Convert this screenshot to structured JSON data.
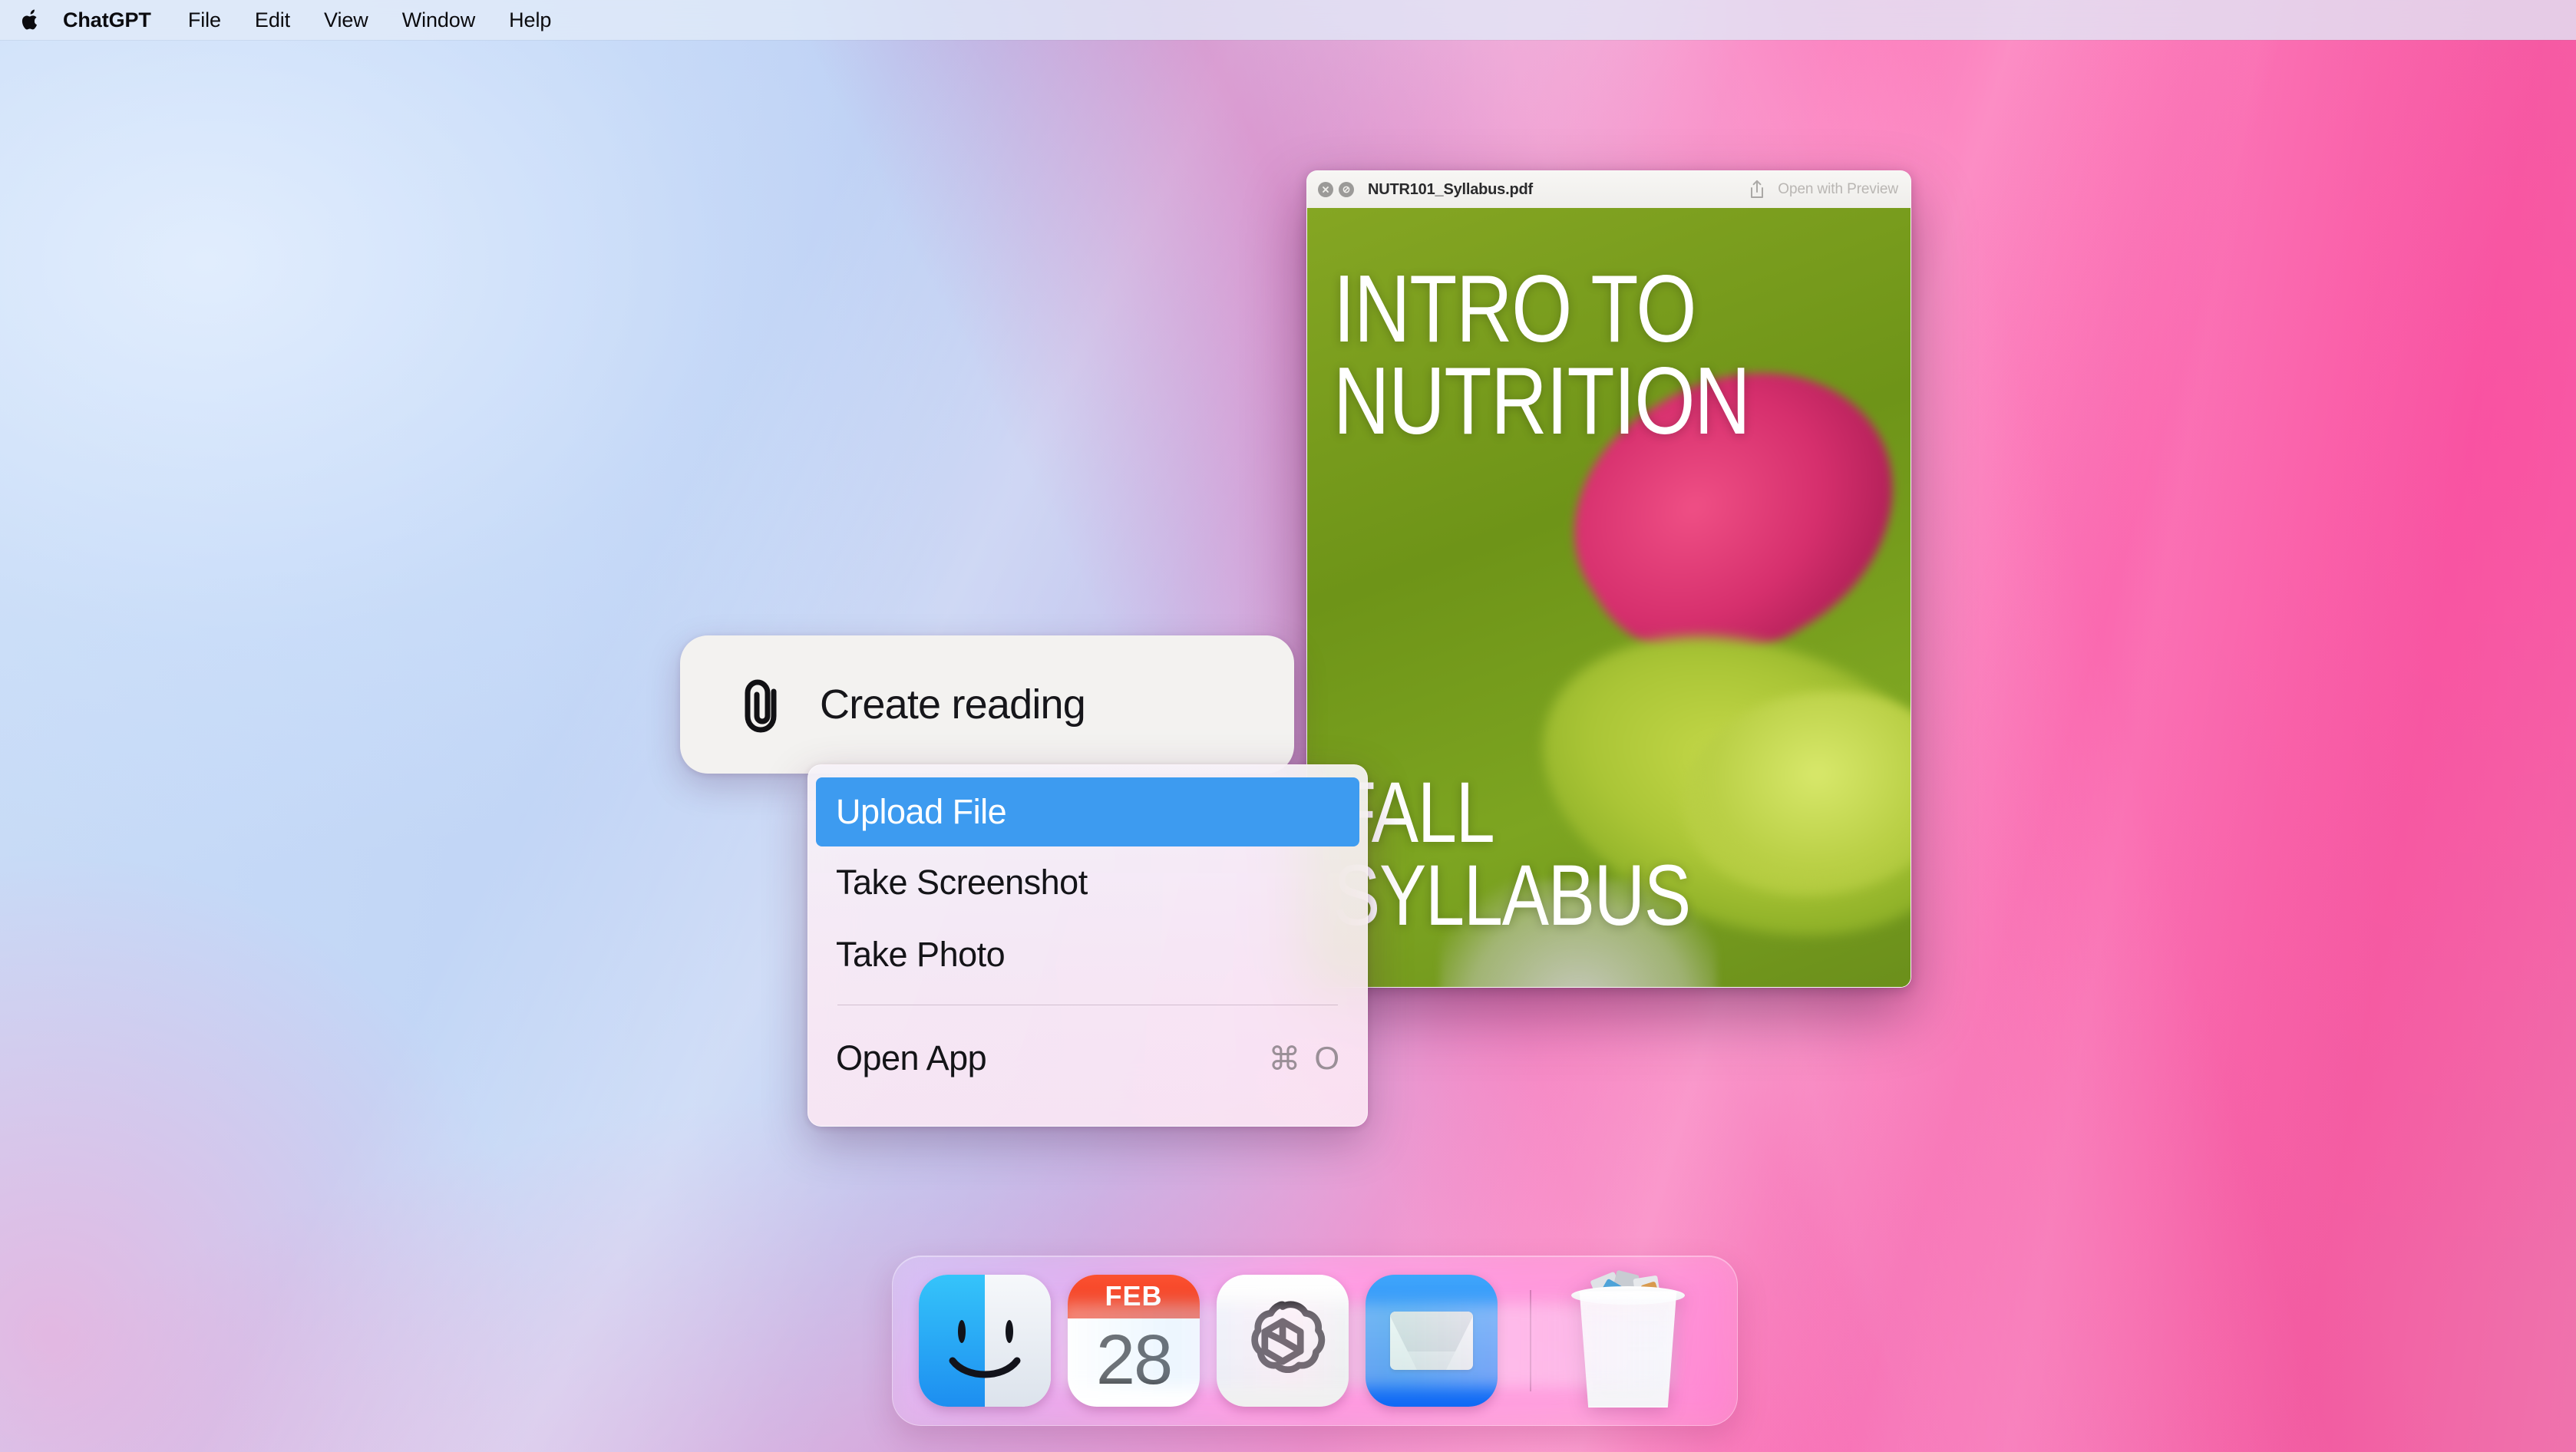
{
  "menubar": {
    "apple_icon": "apple-logo-icon",
    "items": [
      {
        "label": "ChatGPT",
        "active": true
      },
      {
        "label": "File"
      },
      {
        "label": "Edit"
      },
      {
        "label": "View"
      },
      {
        "label": "Window"
      },
      {
        "label": "Help"
      }
    ]
  },
  "quicklook": {
    "title": "NUTR101_Syllabus.pdf",
    "close_icon": "close-icon",
    "fullscreen_icon": "expand-icon",
    "share_icon": "share-icon",
    "open_with_label": "Open with Preview",
    "document": {
      "headline": "INTRO TO\nNUTRITION",
      "subhead": "FALL\nSYLLABUS"
    }
  },
  "create_pill": {
    "attachment_icon": "paperclip-icon",
    "label": "Create reading"
  },
  "upload_menu": {
    "items": [
      {
        "label": "Upload File",
        "selected": true,
        "shortcut": ""
      },
      {
        "label": "Take Screenshot",
        "selected": false,
        "shortcut": ""
      },
      {
        "label": "Take Photo",
        "selected": false,
        "shortcut": ""
      }
    ],
    "footer_items": [
      {
        "label": "Open App",
        "shortcut_modifier": "⌘",
        "shortcut_key": "O"
      }
    ],
    "highlight_color": "#3d9bf0"
  },
  "dock": {
    "apps": [
      {
        "name": "Finder",
        "icon": "finder-icon"
      },
      {
        "name": "Calendar",
        "icon": "calendar-icon",
        "month": "FEB",
        "day": "28"
      },
      {
        "name": "ChatGPT",
        "icon": "chatgpt-icon"
      },
      {
        "name": "Mail",
        "icon": "mail-icon"
      }
    ],
    "trash": {
      "name": "Trash",
      "icon": "trash-icon"
    }
  },
  "colors": {
    "accent_blue": "#3d9bf0",
    "wallpaper_left": "#c9dcf6",
    "wallpaper_right": "#f84f9f",
    "calendar_red": "#ef3a20",
    "mail_blue": "#1069f5"
  }
}
